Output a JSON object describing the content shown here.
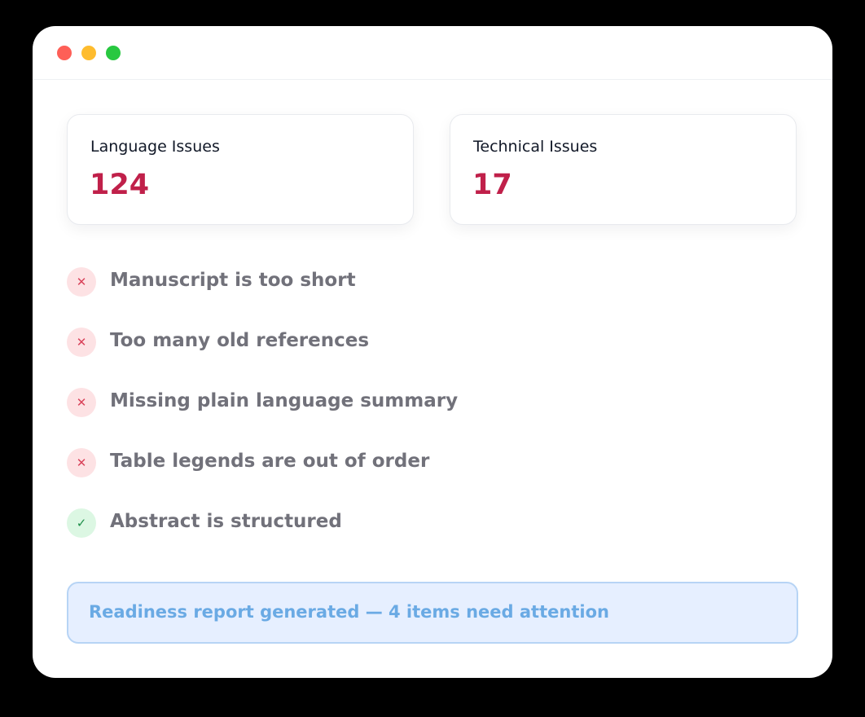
{
  "cards": [
    {
      "label": "Language Issues",
      "value": "124"
    },
    {
      "label": "Technical Issues",
      "value": "17"
    }
  ],
  "checks": [
    {
      "status": "fail",
      "icon": "x-icon",
      "symbol": "✕",
      "label": "Manuscript is too short"
    },
    {
      "status": "fail",
      "icon": "x-icon",
      "symbol": "✕",
      "label": "Too many old references"
    },
    {
      "status": "fail",
      "icon": "x-icon",
      "symbol": "✕",
      "label": "Missing plain language summary"
    },
    {
      "status": "fail",
      "icon": "x-icon",
      "symbol": "✕",
      "label": "Table legends are out of order"
    },
    {
      "status": "pass",
      "icon": "check-icon",
      "symbol": "✓",
      "label": "Abstract is structured"
    }
  ],
  "banner": {
    "text": "Readiness report generated — 4 items need attention"
  },
  "colors": {
    "window_close": "#fe5f57",
    "window_minimize": "#febc2e",
    "window_maximize": "#28c840",
    "issue_count": "#c0204a",
    "fail_icon_bg": "#fde2e4",
    "pass_icon_bg": "#dcf7e3",
    "banner_bg": "#e6efff",
    "banner_text": "#6aaae4"
  }
}
